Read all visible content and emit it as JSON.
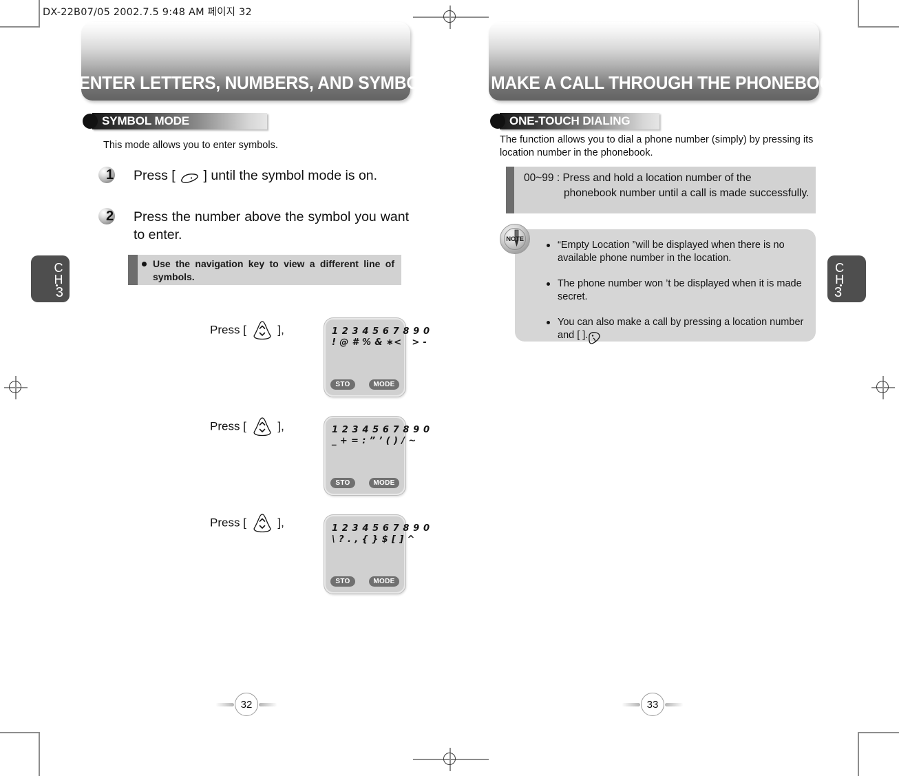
{
  "print_slug": "DX-22B07/05  2002.7.5 9:48 AM  페이지 32",
  "left_page": {
    "banner_title": "TO ENTER LETTERS, NUMBERS, AND SYMBOLS",
    "section_label": "SYMBOL MODE",
    "intro": "This mode allows you to enter symbols.",
    "steps": [
      {
        "num": "1",
        "text_before": "Press [",
        "text_after": "] until the symbol mode is on.",
        "icon": "mode-key-icon"
      },
      {
        "num": "2",
        "text": "Press the number above the symbol you want to enter."
      }
    ],
    "tip": "Use the navigation key to view a different line of symbols.",
    "press_label_before": "Press [",
    "press_label_after": "],",
    "nav_icon": "navigation-key-icon",
    "screens": [
      {
        "line1": "1 2 3 4 5 6 7 8 9 0",
        "line2": "! @ # % & ∗<   > -",
        "softkey_left": "STO",
        "softkey_right": "MODE"
      },
      {
        "line1": "1 2 3 4 5 6 7 8 9 0",
        "line2": "_ + = : ” ’ ( ) / ~",
        "softkey_left": "STO",
        "softkey_right": "MODE"
      },
      {
        "line1": "1 2 3 4 5 6 7 8 9 0",
        "line2": "\\ ? . , { } $ [ ] ^",
        "softkey_left": "STO",
        "softkey_right": "MODE"
      }
    ],
    "chapter_tab": {
      "letters": "CH",
      "number": "3"
    },
    "page_number": "32"
  },
  "right_page": {
    "banner_title": "TO MAKE A CALL THROUGH THE PHONEBOOK",
    "section_label": "ONE-TOUCH DIALING",
    "intro": "The function allows you to dial a phone number (simply) by  pressing its location number in the phonebook.",
    "range_note_lead": "00~99 : Press and hold a location number of the",
    "range_note_rest": "phonebook number until a call is made successfully.",
    "note_badge_label": "NOTE",
    "notes": [
      "“Empty Location ”will be displayed when there is no available phone number in the location.",
      "The phone number won ’t be displayed when it is made secret.",
      "You can also make a call by pressing a location number and [    ]."
    ],
    "send_key_icon": "send-key-icon",
    "chapter_tab": {
      "letters": "CH",
      "number": "3"
    },
    "page_number": "33"
  }
}
